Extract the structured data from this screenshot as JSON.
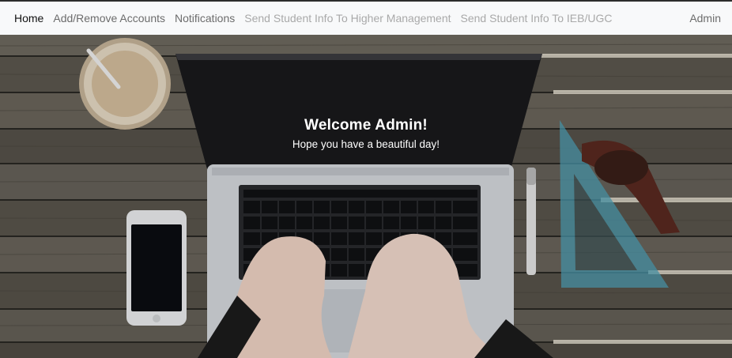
{
  "navbar": {
    "items": [
      {
        "label": "Home"
      },
      {
        "label": "Add/Remove Accounts"
      },
      {
        "label": "Notifications"
      },
      {
        "label": "Send Student Info To Higher Management"
      },
      {
        "label": "Send Student Info To IEB/UGC"
      }
    ],
    "user_label": "Admin"
  },
  "hero": {
    "title": "Welcome Admin!",
    "subtitle": "Hope you have a beautiful day!"
  }
}
